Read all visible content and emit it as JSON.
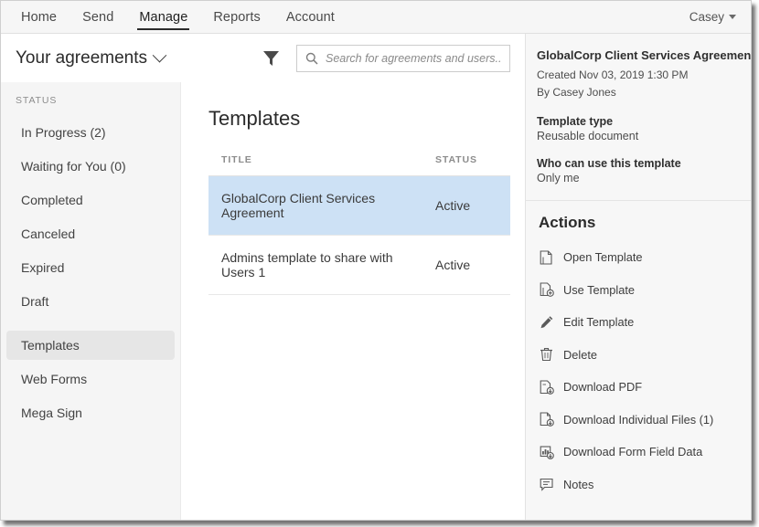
{
  "topnav": {
    "items": [
      {
        "label": "Home",
        "active": false
      },
      {
        "label": "Send",
        "active": false
      },
      {
        "label": "Manage",
        "active": true
      },
      {
        "label": "Reports",
        "active": false
      },
      {
        "label": "Account",
        "active": false
      }
    ],
    "user": "Casey"
  },
  "sidebar": {
    "title": "Your agreements",
    "status_label": "STATUS",
    "items": [
      {
        "label": "In Progress (2)",
        "selected": false
      },
      {
        "label": "Waiting for You (0)",
        "selected": false
      },
      {
        "label": "Completed",
        "selected": false
      },
      {
        "label": "Canceled",
        "selected": false
      },
      {
        "label": "Expired",
        "selected": false
      },
      {
        "label": "Draft",
        "selected": false
      }
    ],
    "items2": [
      {
        "label": "Templates",
        "selected": true
      },
      {
        "label": "Web Forms",
        "selected": false
      },
      {
        "label": "Mega Sign",
        "selected": false
      }
    ]
  },
  "search": {
    "placeholder": "Search for agreements and users...",
    "value": ""
  },
  "main": {
    "title": "Templates",
    "columns": [
      "TITLE",
      "STATUS"
    ],
    "rows": [
      {
        "title": "GlobalCorp Client Services Agreement",
        "status": "Active",
        "selected": true
      },
      {
        "title": "Admins template to share with Users 1",
        "status": "Active",
        "selected": false
      }
    ]
  },
  "details": {
    "doc_title": "GlobalCorp Client Services Agreement",
    "created": "Created Nov 03, 2019 1:30 PM",
    "author": "By Casey Jones",
    "template_type_label": "Template type",
    "template_type_value": "Reusable document",
    "who_label": "Who can use this template",
    "who_value": "Only me"
  },
  "actions": {
    "title": "Actions",
    "items": [
      {
        "label": "Open Template",
        "icon": "document-icon"
      },
      {
        "label": "Use Template",
        "icon": "document-add-icon"
      },
      {
        "label": "Edit Template",
        "icon": "pencil-icon"
      },
      {
        "label": "Delete",
        "icon": "trash-icon"
      },
      {
        "label": "Download PDF",
        "icon": "pdf-download-icon"
      },
      {
        "label": "Download Individual Files (1)",
        "icon": "files-download-icon"
      },
      {
        "label": "Download Form Field Data",
        "icon": "formdata-download-icon"
      },
      {
        "label": "Notes",
        "icon": "note-icon"
      }
    ]
  },
  "colors": {
    "selected_row": "#cde1f5",
    "sidebar_selected": "#e6e6e6",
    "panel_bg": "#f7f7f7",
    "nav_bg": "#f6f6f6"
  }
}
